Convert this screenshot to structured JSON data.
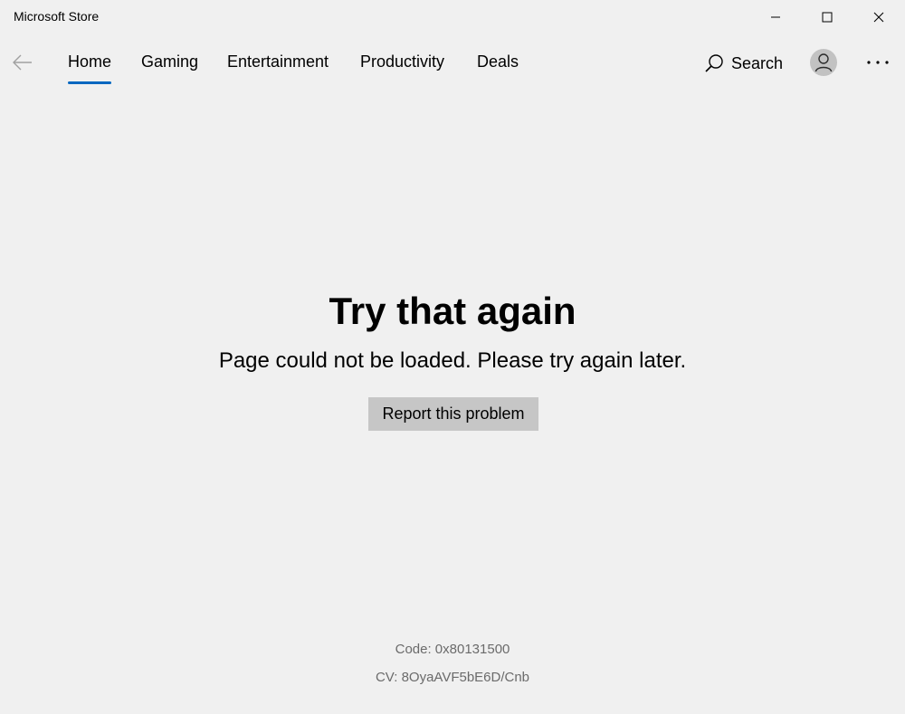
{
  "window": {
    "title": "Microsoft Store"
  },
  "titlebar_controls": {
    "minimize_icon": "minimize-icon",
    "maximize_icon": "maximize-icon",
    "close_icon": "close-icon"
  },
  "nav": {
    "back_icon": "back-arrow-icon",
    "tabs": [
      {
        "label": "Home",
        "active": true
      },
      {
        "label": "Gaming",
        "active": false
      },
      {
        "label": "Entertainment",
        "active": false
      },
      {
        "label": "Productivity",
        "active": false
      },
      {
        "label": "Deals",
        "active": false
      }
    ],
    "search_label": "Search",
    "search_icon": "search-icon",
    "avatar_icon": "user-avatar-icon",
    "more_icon": "more-options-icon"
  },
  "error": {
    "title": "Try that again",
    "message": "Page could not be loaded. Please try again later.",
    "report_button": "Report this problem",
    "code": "Code: 0x80131500",
    "cv": "CV: 8OyaAVF5bE6D/Cnb"
  },
  "colors": {
    "background": "#f0f0f0",
    "accent": "#0067c0",
    "button": "#c6c6c6",
    "secondary_text": "#6b6b6b"
  }
}
